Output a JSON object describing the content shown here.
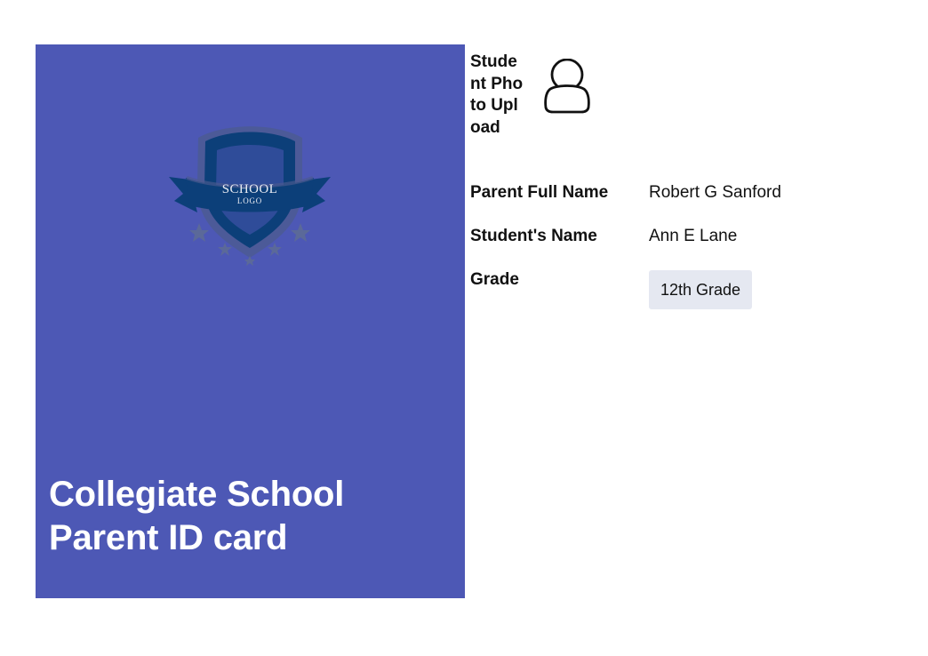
{
  "card": {
    "title_line1": "Collegiate School",
    "title_line2": "Parent ID card",
    "logo": {
      "line1": "SCHOOL",
      "line2": "LOGO"
    }
  },
  "form": {
    "photo_label": "Student Photo Upload",
    "photo_icon": "person-upload-icon",
    "parent_label": "Parent Full Name",
    "parent_value": "Robert G Sanford",
    "student_label": "Student's Name",
    "student_value": "Ann E Lane",
    "grade_label": "Grade",
    "grade_value": "12th Grade"
  },
  "colors": {
    "card_background": "#4d58b5",
    "logo_navy": "#0c3f79",
    "grade_field_background": "#e5e8f1",
    "card_text": "#ffffff"
  }
}
